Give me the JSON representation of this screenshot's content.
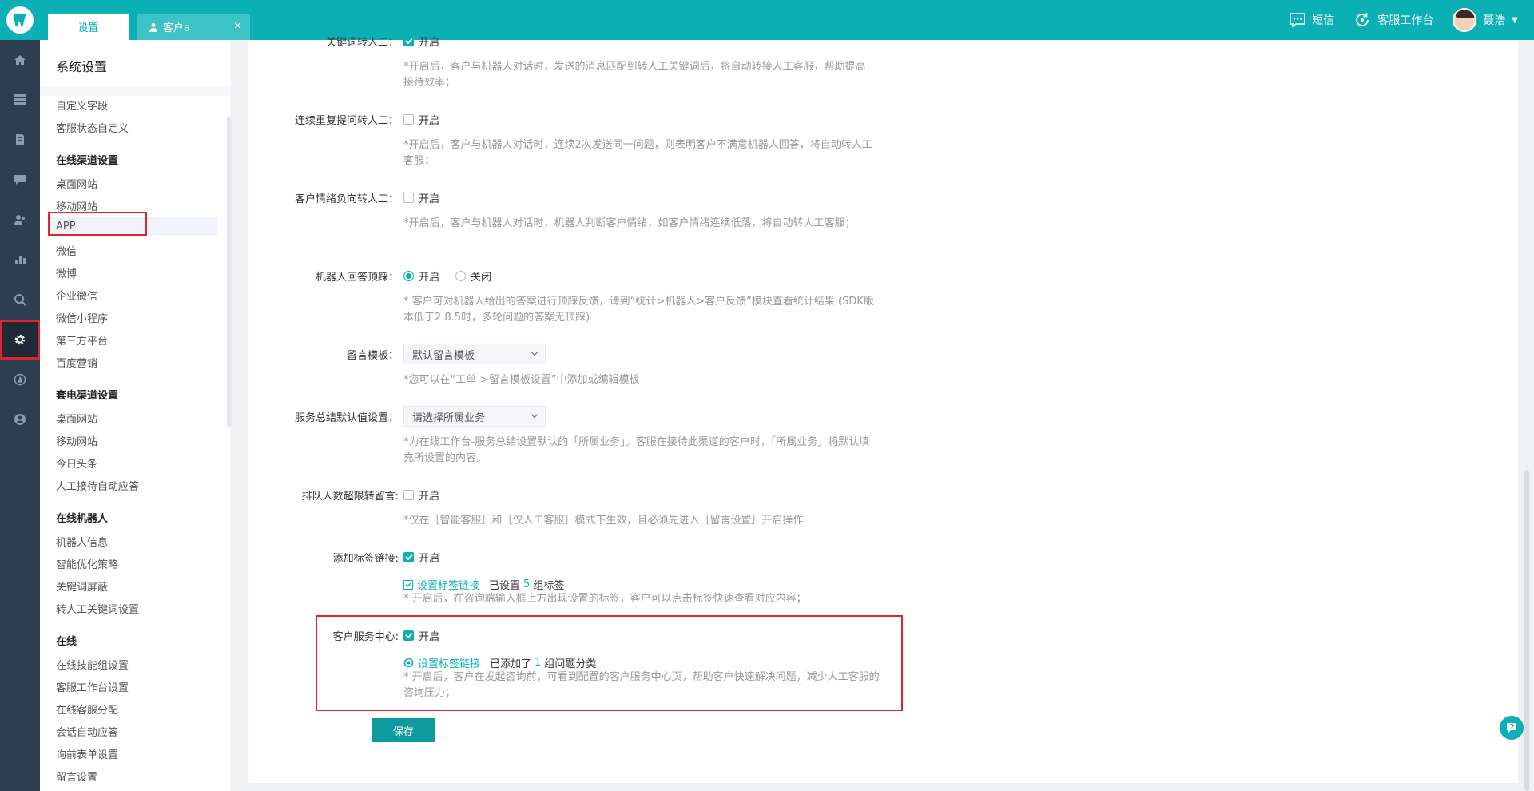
{
  "header": {
    "tabs": [
      {
        "label": "设置"
      },
      {
        "label": "客户a"
      }
    ],
    "tab_close": "×",
    "sms_label": "短信",
    "workbench_label": "客服工作台",
    "user_name": "聂浩",
    "caret": "▼"
  },
  "sidebar": {
    "title": "系统设置",
    "items": [
      {
        "label": "自定义字段",
        "type": "item"
      },
      {
        "label": "客服状态自定义",
        "type": "item"
      },
      {
        "label": "在线渠道设置",
        "type": "head"
      },
      {
        "label": "桌面网站",
        "type": "item"
      },
      {
        "label": "移动网站",
        "type": "item"
      },
      {
        "label": "APP",
        "type": "item",
        "selected": true
      },
      {
        "label": "微信",
        "type": "item"
      },
      {
        "label": "微博",
        "type": "item"
      },
      {
        "label": "企业微信",
        "type": "item"
      },
      {
        "label": "微信小程序",
        "type": "item"
      },
      {
        "label": "第三方平台",
        "type": "item"
      },
      {
        "label": "百度营销",
        "type": "item"
      },
      {
        "label": "套电渠道设置",
        "type": "head"
      },
      {
        "label": "桌面网站",
        "type": "item"
      },
      {
        "label": "移动网站",
        "type": "item"
      },
      {
        "label": "今日头条",
        "type": "item"
      },
      {
        "label": "人工接待自动应答",
        "type": "item"
      },
      {
        "label": "在线机器人",
        "type": "head"
      },
      {
        "label": "机器人信息",
        "type": "item"
      },
      {
        "label": "智能优化策略",
        "type": "item"
      },
      {
        "label": "关键词屏蔽",
        "type": "item"
      },
      {
        "label": "转人工关键词设置",
        "type": "item"
      },
      {
        "label": "在线",
        "type": "head"
      },
      {
        "label": "在线技能组设置",
        "type": "item"
      },
      {
        "label": "客服工作台设置",
        "type": "item"
      },
      {
        "label": "在线客服分配",
        "type": "item"
      },
      {
        "label": "会话自动应答",
        "type": "item"
      },
      {
        "label": "询前表单设置",
        "type": "item"
      },
      {
        "label": "留言设置",
        "type": "item"
      }
    ]
  },
  "main": {
    "keyword_transfer": {
      "label": "关键词转人工：",
      "option": "开启",
      "checked": true,
      "hint": "*开启后，客户与机器人对话时，发送的消息匹配到转人工关键词后，将自动转接人工客服，帮助提高接待效率；"
    },
    "repeat_transfer": {
      "label": "连续重复提问转人工：",
      "option": "开启",
      "checked": false,
      "hint": "*开启后，客户与机器人对话时，连续2次发送同一问题，则表明客户不满意机器人回答，将自动转人工客服；"
    },
    "emotion_transfer": {
      "label": "客户情绪负向转人工：",
      "option": "开启",
      "checked": false,
      "hint": "*开启后，客户与机器人对话时，机器人判断客户情绪，如客户情绪连续低落，将自动转人工客服；"
    },
    "robot_feedback": {
      "label": "机器人回答顶踩：",
      "option_on": "开启",
      "option_off": "关闭",
      "hint": "* 客户可对机器人给出的答案进行顶踩反馈，请到“统计>机器人>客户反馈”模块查看统计结果 (SDK版本低于2.8.5时，多轮问题的答案无顶踩)"
    },
    "message_template": {
      "label": "留言模板：",
      "value": "默认留言模板",
      "hint": "*您可以在“工单->留言模板设置”中添加或编辑模板"
    },
    "service_summary": {
      "label": "服务总结默认值设置：",
      "value": "请选择所属业务",
      "hint": "*为在线工作台-服务总结设置默认的「所属业务」。客服在接待此渠道的客户时，「所属业务」将默认填充所设置的内容。"
    },
    "queue_overflow": {
      "label": "排队人数超限转留言:",
      "option": "开启",
      "checked": false,
      "hint": "*仅在［智能客服］和［仅人工客服］模式下生效，且必须先进入［留言设置］开启操作"
    },
    "tag_links": {
      "label": "添加标签链接:",
      "option": "开启",
      "checked": true,
      "link": "设置标签链接",
      "status_prefix": "已设置",
      "count": "5",
      "status_suffix": "组标签",
      "hint": "* 开启后，在咨询端输入框上方出现设置的标签，客户可以点击标签快速查看对应内容；"
    },
    "service_center": {
      "label": "客户服务中心:",
      "option": "开启",
      "checked": true,
      "link": "设置标签链接",
      "status_prefix": "已添加了",
      "count": "1",
      "status_suffix": "组问题分类",
      "hint": "* 开启后，客户在发起咨询前，可看到配置的客户服务中心页，帮助客户快速解决问题，减少人工客服的咨询压力；"
    },
    "save_label": "保存"
  },
  "colors": {
    "accent": "#0ab0b4",
    "nav_bg": "#2c3e50",
    "highlight": "#e0242b"
  }
}
